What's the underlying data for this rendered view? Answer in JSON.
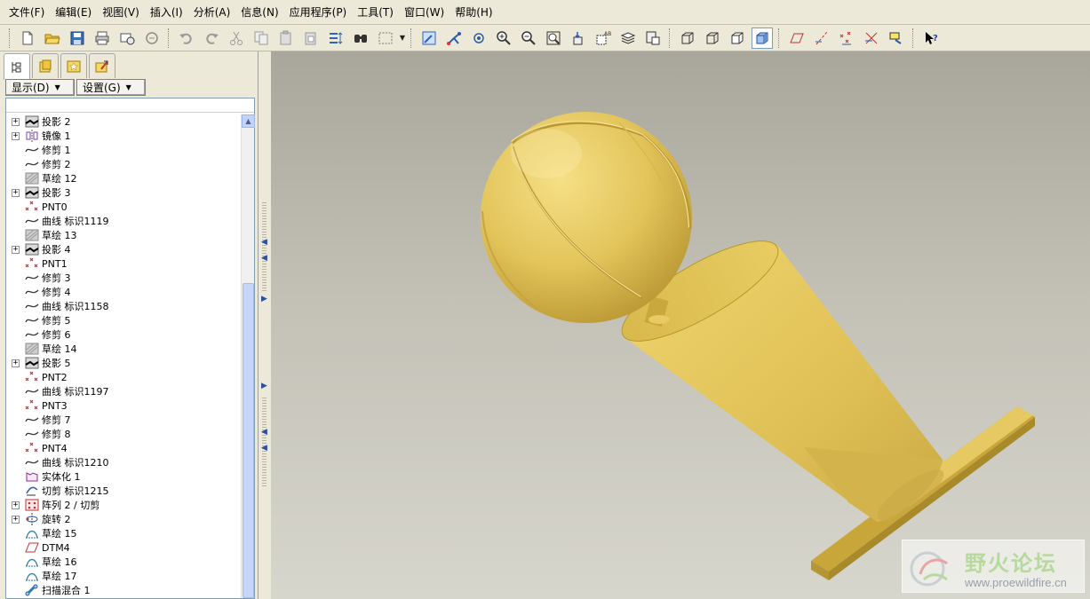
{
  "menu": [
    "文件(F)",
    "编辑(E)",
    "视图(V)",
    "插入(I)",
    "分析(A)",
    "信息(N)",
    "应用程序(P)",
    "工具(T)",
    "窗口(W)",
    "帮助(H)"
  ],
  "panel": {
    "show_label": "显示(D)",
    "settings_label": "设置(G)"
  },
  "tree": [
    {
      "label": "投影 2",
      "icon": "projection-icon",
      "expand": true
    },
    {
      "label": "镜像 1",
      "icon": "mirror-icon",
      "expand": true
    },
    {
      "label": "修剪 1",
      "icon": "curve-icon",
      "expand": false
    },
    {
      "label": "修剪 2",
      "icon": "curve-icon",
      "expand": false
    },
    {
      "label": "草绘 12",
      "icon": "sketch-icon",
      "expand": false
    },
    {
      "label": "投影 3",
      "icon": "projection-icon",
      "expand": true
    },
    {
      "label": "PNT0",
      "icon": "point-icon",
      "expand": false
    },
    {
      "label": "曲线 标识1119",
      "icon": "curve-icon",
      "expand": false
    },
    {
      "label": "草绘 13",
      "icon": "sketch-icon",
      "expand": false
    },
    {
      "label": "投影 4",
      "icon": "projection-icon",
      "expand": true
    },
    {
      "label": "PNT1",
      "icon": "point-icon",
      "expand": false
    },
    {
      "label": "修剪 3",
      "icon": "curve-icon",
      "expand": false
    },
    {
      "label": "修剪 4",
      "icon": "curve-icon",
      "expand": false
    },
    {
      "label": "曲线 标识1158",
      "icon": "curve-icon",
      "expand": false
    },
    {
      "label": "修剪 5",
      "icon": "curve-icon",
      "expand": false
    },
    {
      "label": "修剪 6",
      "icon": "curve-icon",
      "expand": false
    },
    {
      "label": "草绘 14",
      "icon": "sketch-icon",
      "expand": false
    },
    {
      "label": "投影 5",
      "icon": "projection-icon",
      "expand": true
    },
    {
      "label": "PNT2",
      "icon": "point-icon",
      "expand": false
    },
    {
      "label": "曲线 标识1197",
      "icon": "curve-icon",
      "expand": false
    },
    {
      "label": "PNT3",
      "icon": "point-icon",
      "expand": false
    },
    {
      "label": "修剪 7",
      "icon": "curve-icon",
      "expand": false
    },
    {
      "label": "修剪 8",
      "icon": "curve-icon",
      "expand": false
    },
    {
      "label": "PNT4",
      "icon": "point-icon",
      "expand": false
    },
    {
      "label": "曲线 标识1210",
      "icon": "curve-icon",
      "expand": false
    },
    {
      "label": "实体化 1",
      "icon": "solidify-icon",
      "expand": false
    },
    {
      "label": "切剪 标识1215",
      "icon": "cut-icon",
      "expand": false
    },
    {
      "label": "阵列 2 / 切剪",
      "icon": "pattern-icon",
      "expand": true
    },
    {
      "label": "旋转 2",
      "icon": "revolve-icon",
      "expand": true
    },
    {
      "label": "草绘 15",
      "icon": "sketch2-icon",
      "expand": false
    },
    {
      "label": "DTM4",
      "icon": "plane-icon",
      "expand": false
    },
    {
      "label": "草绘 16",
      "icon": "sketch2-icon",
      "expand": false
    },
    {
      "label": "草绘 17",
      "icon": "sketch2-icon",
      "expand": false
    },
    {
      "label": "扫描混合 1",
      "icon": "sweep-blend-icon",
      "expand": false
    }
  ],
  "watermark": {
    "title": "野火论坛",
    "url": "www.proewildfire.cn"
  },
  "colors": {
    "model_gold": "#e0c35a",
    "model_shadow": "#a88a2a",
    "viewport_top": "#a9a79c",
    "viewport_bottom": "#d7d6cd"
  }
}
